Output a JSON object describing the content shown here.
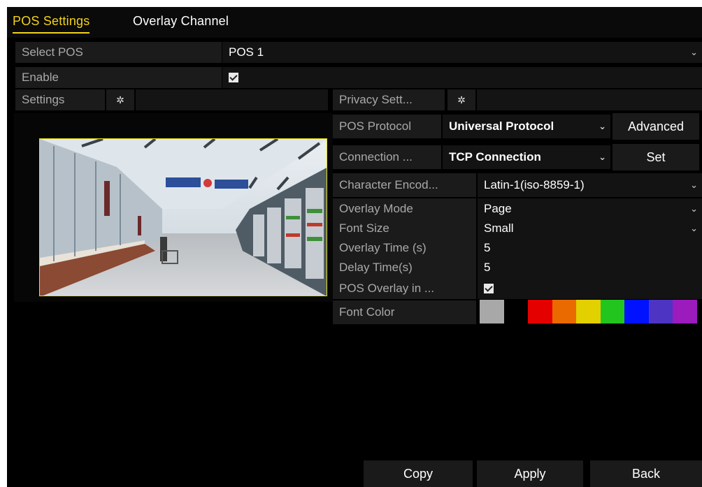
{
  "tabs": {
    "pos_settings": "POS Settings",
    "overlay_channel": "Overlay Channel"
  },
  "select_pos": {
    "label": "Select POS",
    "value": "POS 1"
  },
  "enable": {
    "label": "Enable",
    "checked": true
  },
  "settings": {
    "label": "Settings",
    "icon": "gear-icon"
  },
  "privacy": {
    "label": "Privacy Sett...",
    "icon": "gear-icon"
  },
  "pos_protocol": {
    "label": "POS Protocol",
    "value": "Universal Protocol",
    "button": "Advanced"
  },
  "connection": {
    "label": "Connection ...",
    "value": "TCP Connection",
    "button": "Set"
  },
  "character_encoding": {
    "label": "Character Encod...",
    "value": "Latin-1(iso-8859-1)"
  },
  "overlay_mode": {
    "label": "Overlay Mode",
    "value": "Page"
  },
  "font_size": {
    "label": "Font Size",
    "value": "Small"
  },
  "overlay_time": {
    "label": "Overlay Time (s)",
    "value": "5"
  },
  "delay_time": {
    "label": "Delay Time(s)",
    "value": "5"
  },
  "pos_overlay_live": {
    "label": "POS Overlay in ...",
    "checked": true
  },
  "font_color": {
    "label": "Font Color",
    "swatches": [
      "#a8a8a8",
      "#000000",
      "#e50000",
      "#ea6a00",
      "#e3d000",
      "#22c51e",
      "#0012ff",
      "#4d34c3",
      "#9b1bbd"
    ]
  },
  "footer": {
    "copy": "Copy",
    "apply": "Apply",
    "back": "Back"
  }
}
